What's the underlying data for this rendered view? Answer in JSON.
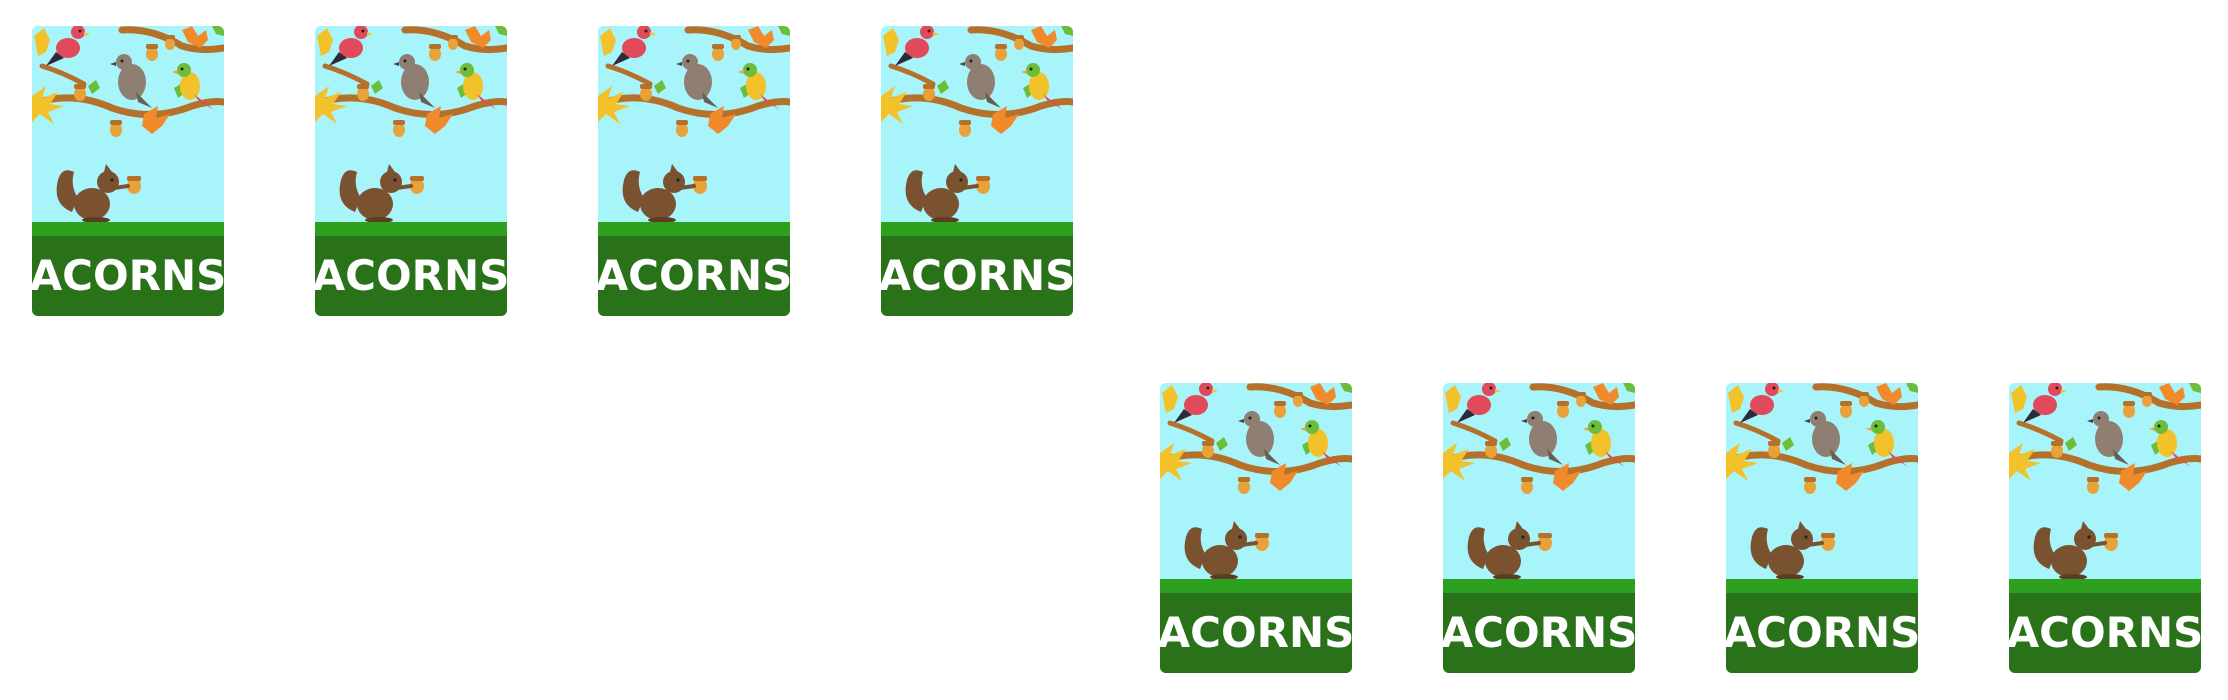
{
  "card_label": "ACORNS",
  "colors": {
    "sky": "#a8f4fb",
    "grass": "#2ea020",
    "label_background": "#2a7219",
    "label_text": "#ffffff",
    "branch": "#b5702a",
    "acorn": "#e8a23a",
    "squirrel": "#7a5230"
  },
  "icons": [
    "red-bird-icon",
    "gray-bird-icon",
    "yellow-bird-icon",
    "squirrel-icon",
    "acorn-icon",
    "branch-icon",
    "leaf-icon"
  ]
}
